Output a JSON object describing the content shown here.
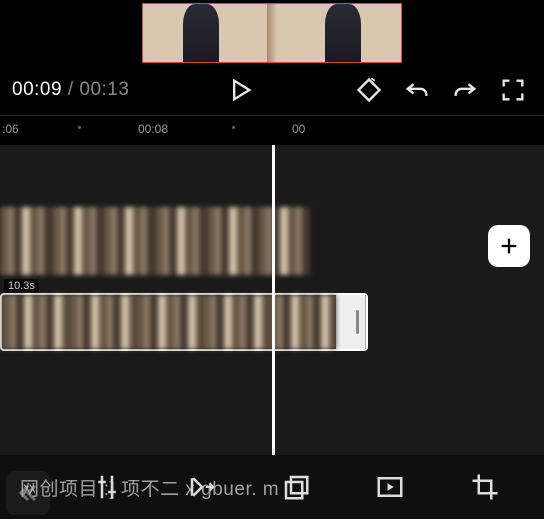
{
  "playback": {
    "current": "00:09",
    "separator": " / ",
    "total": "00:13"
  },
  "ruler": {
    "t1": ":06",
    "t2": "00:08",
    "t3": "00"
  },
  "clip": {
    "duration": "10.3s"
  },
  "icons": {
    "play": "play",
    "keyframe": "keyframe",
    "undo": "undo",
    "redo": "redo",
    "fullscreen": "fullscreen",
    "add": "add",
    "back": "back",
    "split": "split",
    "speed": "speed",
    "copy_layers": "copy",
    "pip": "pip",
    "crop": "crop"
  },
  "watermark": "网创项目 :] 项不二  x    gbuer.    m"
}
